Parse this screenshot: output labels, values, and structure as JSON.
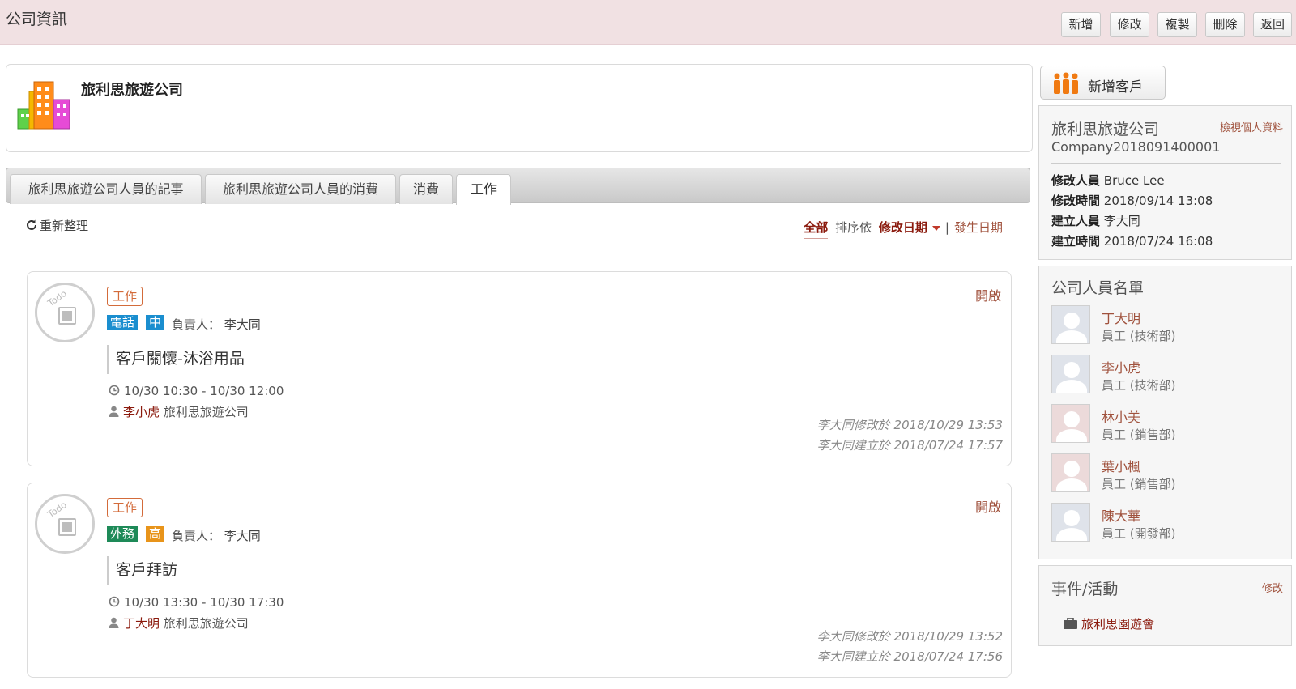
{
  "header": {
    "title": "公司資訊",
    "buttons": [
      "新增",
      "修改",
      "複製",
      "刪除",
      "返回"
    ]
  },
  "company": {
    "name": "旅利思旅遊公司"
  },
  "tabs": [
    "旅利思旅遊公司人員的記事",
    "旅利思旅遊公司人員的消費",
    "消費",
    "工作"
  ],
  "active_tab": "工作",
  "toolbar": {
    "refresh": "重新整理",
    "filter_all": "全部",
    "sort_label": "排序依",
    "sort_selected": "修改日期",
    "sort_separator": "|",
    "sort_alt": "發生日期"
  },
  "tasks": [
    {
      "todo": "Todo",
      "tag": "工作",
      "type": "電話",
      "type_color": "#1a8ecf",
      "priority": "中",
      "priority_color": "#1a8ecf",
      "owner_label": "負責人：",
      "owner": "李大同",
      "open": "開啟",
      "subject": "客戶關懷-沐浴用品",
      "time": "10/30 10:30 - 10/30 12:00",
      "contact_person": "李小虎",
      "contact_company": "旅利思旅遊公司",
      "modified": "李大同修改於 2018/10/29 13:53",
      "created": "李大同建立於 2018/07/24 17:57"
    },
    {
      "todo": "Todo",
      "tag": "工作",
      "type": "外務",
      "type_color": "#1e8a58",
      "priority": "高",
      "priority_color": "#e8941a",
      "owner_label": "負責人：",
      "owner": "李大同",
      "open": "開啟",
      "subject": "客戶拜訪",
      "time": "10/30 13:30 - 10/30 17:30",
      "contact_person": "丁大明",
      "contact_company": "旅利思旅遊公司",
      "modified": "李大同修改於 2018/10/29 13:52",
      "created": "李大同建立於 2018/07/24 17:56"
    }
  ],
  "sidebar": {
    "add_customer": "新增客戶",
    "profile": {
      "name": "旅利思旅遊公司",
      "view_link": "檢視個人資料",
      "code": "Company2018091400001",
      "fields": [
        {
          "label": "修改人員",
          "value": "Bruce Lee"
        },
        {
          "label": "修改時間",
          "value": "2018/09/14 13:08"
        },
        {
          "label": "建立人員",
          "value": "李大同"
        },
        {
          "label": "建立時間",
          "value": "2018/07/24 16:08"
        }
      ]
    },
    "staff": {
      "title": "公司人員名單",
      "people": [
        {
          "name": "丁大明",
          "role": "員工 (技術部)"
        },
        {
          "name": "李小虎",
          "role": "員工 (技術部)"
        },
        {
          "name": "林小美",
          "role": "員工 (銷售部)"
        },
        {
          "name": "葉小楓",
          "role": "員工 (銷售部)"
        },
        {
          "name": "陳大華",
          "role": "員工 (開發部)"
        }
      ]
    },
    "events": {
      "title": "事件/活動",
      "edit": "修改",
      "items": [
        "旅利思園遊會"
      ]
    }
  },
  "colors": {
    "accent": "#8b1a0d",
    "link": "#a0523d",
    "header_bg": "#f1e1e3"
  }
}
